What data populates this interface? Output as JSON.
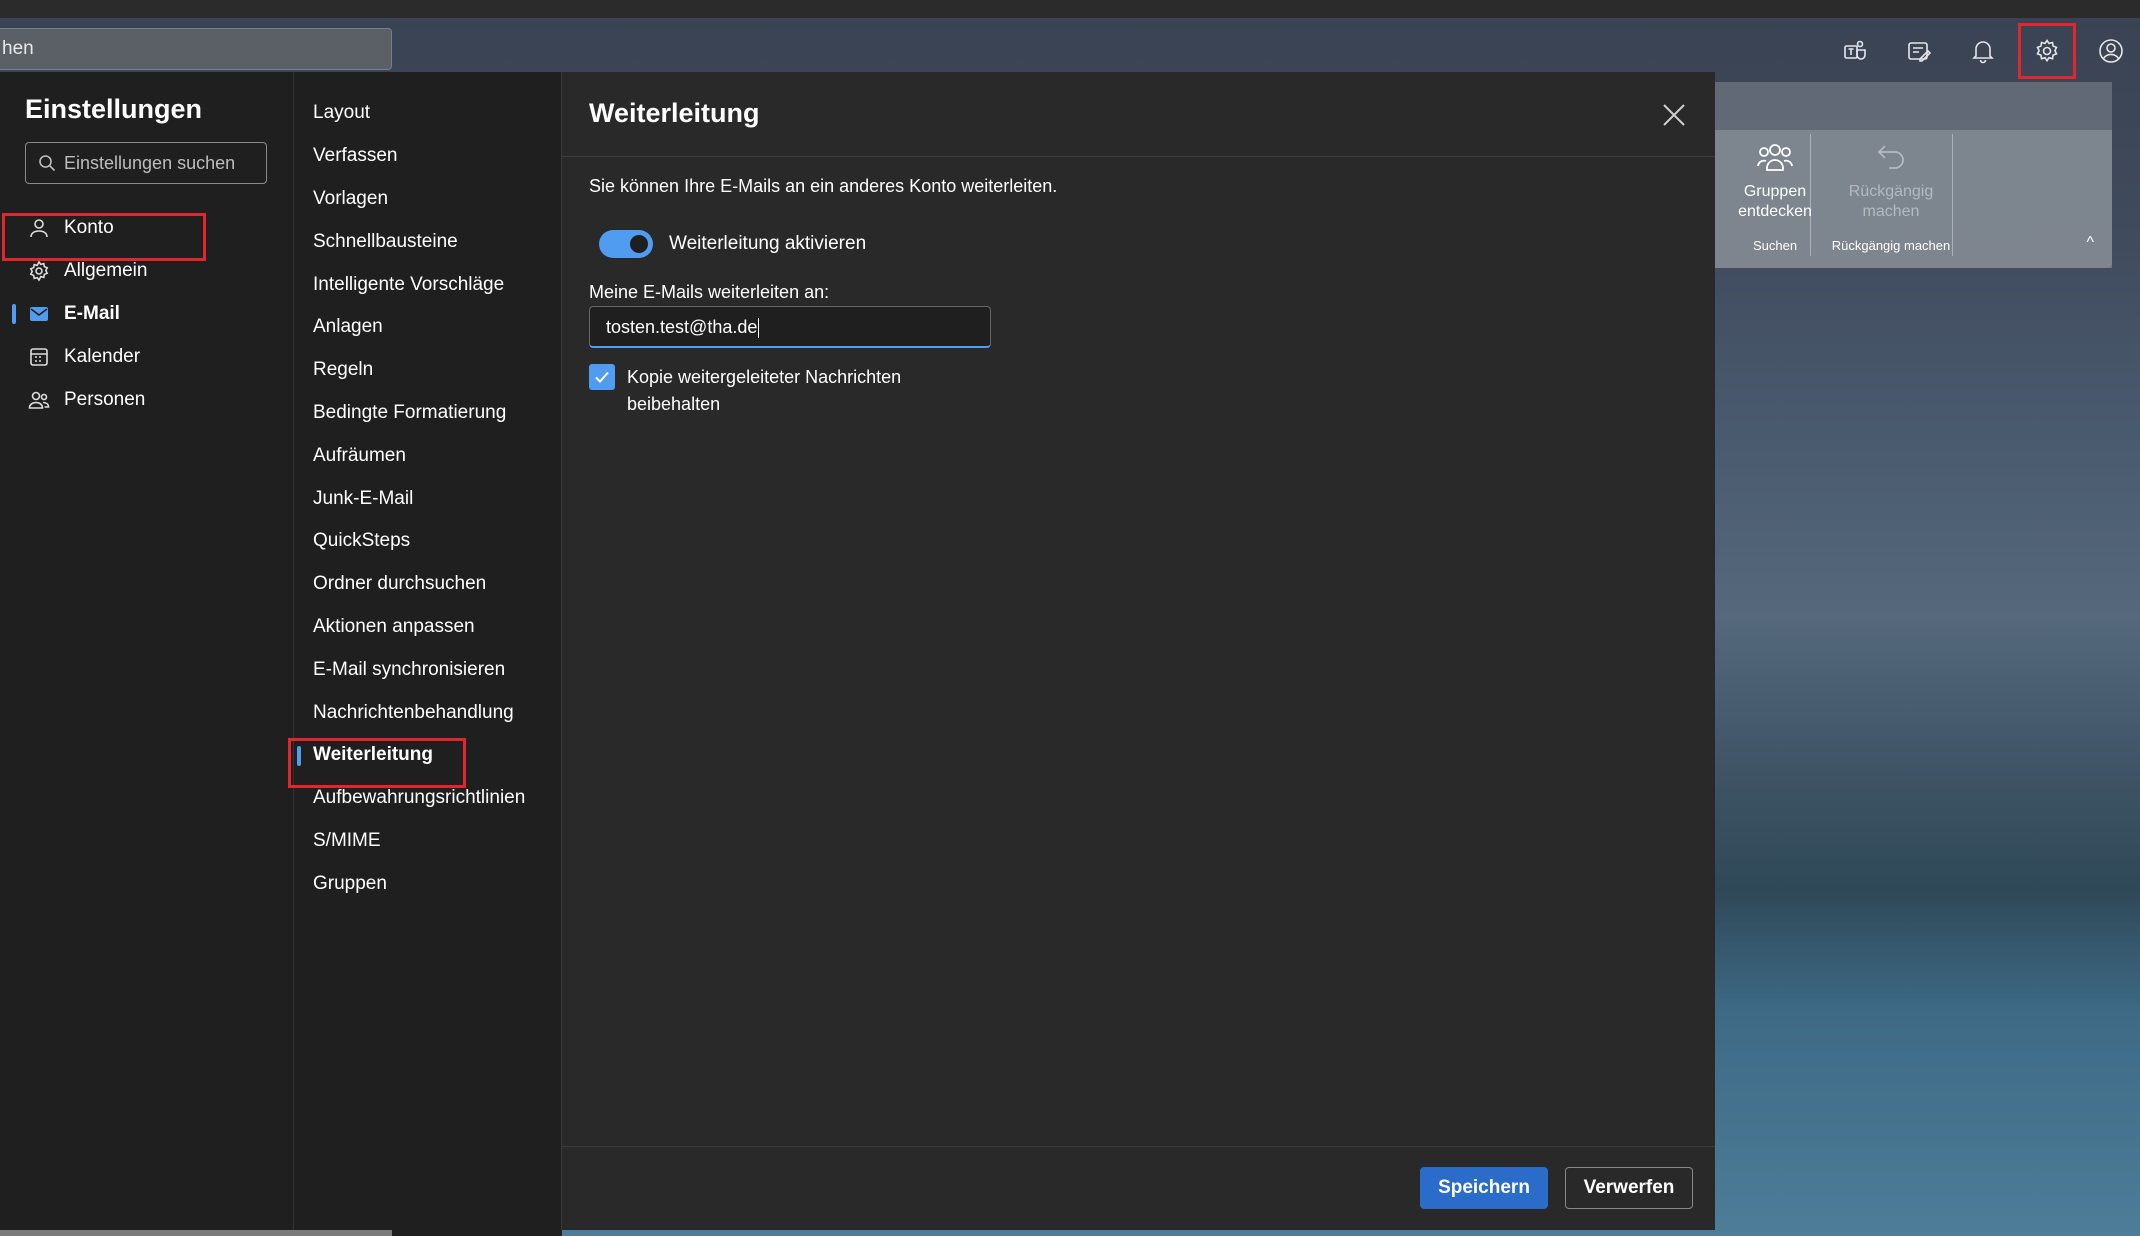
{
  "top_search": {
    "text": "hen"
  },
  "top_icons": [
    {
      "name": "teams-icon"
    },
    {
      "name": "notes-icon"
    },
    {
      "name": "bell-icon"
    },
    {
      "name": "gear-icon"
    },
    {
      "name": "profile-icon"
    }
  ],
  "ribbon": {
    "groups_button_label": "Gruppen entdecken",
    "groups_group_label": "Suchen",
    "undo_button_label": "Rückgängig machen",
    "undo_group_label": "Rückgängig machen",
    "collapse_glyph": "^"
  },
  "settings": {
    "title": "Einstellungen",
    "search_placeholder": "Einstellungen suchen",
    "nav": [
      {
        "label": "Konto",
        "icon": "person-icon"
      },
      {
        "label": "Allgemein",
        "icon": "gear-icon"
      },
      {
        "label": "E-Mail",
        "icon": "mail-icon",
        "selected": true
      },
      {
        "label": "Kalender",
        "icon": "calendar-icon"
      },
      {
        "label": "Personen",
        "icon": "people-icon"
      }
    ],
    "subnav": [
      "Layout",
      "Verfassen",
      "Vorlagen",
      "Schnellbausteine",
      "Intelligente Vorschläge",
      "Anlagen",
      "Regeln",
      "Bedingte Formatierung",
      "Aufräumen",
      "Junk-E-Mail",
      "QuickSteps",
      "Ordner durchsuchen",
      "Aktionen anpassen",
      "E-Mail synchronisieren",
      "Nachrichtenbehandlung",
      "Weiterleitung",
      "Aufbewahrungsrichtlinien",
      "S/MIME",
      "Gruppen"
    ],
    "subnav_selected": "Weiterleitung"
  },
  "forwarding": {
    "title": "Weiterleitung",
    "description": "Sie können Ihre E-Mails an ein anderes Konto weiterleiten.",
    "toggle_label": "Weiterleitung aktivieren",
    "toggle_on": true,
    "field_label": "Meine E-Mails weiterleiten an:",
    "field_value": "tosten.test@tha.de",
    "checkbox_label": "Kopie weitergeleiteter Nachrichten beibehalten",
    "checkbox_checked": true,
    "save_label": "Speichern",
    "discard_label": "Verwerfen"
  },
  "colors": {
    "accent": "#4f9cf0",
    "save_button": "#2b6bc9",
    "highlight_box": "#e0262f",
    "panel_bg": "#1f1f1f",
    "main_bg": "#292929"
  }
}
